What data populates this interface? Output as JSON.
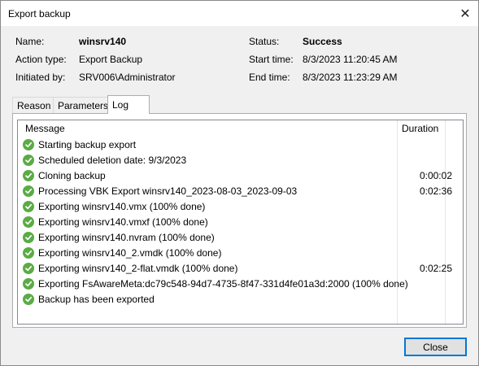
{
  "window": {
    "title": "Export backup",
    "close_glyph": "✕"
  },
  "info": {
    "name_label": "Name:",
    "name_value": "winsrv140",
    "action_label": "Action type:",
    "action_value": "Export Backup",
    "initiated_label": "Initiated by:",
    "initiated_value": "SRV006\\Administrator",
    "status_label": "Status:",
    "status_value": "Success",
    "start_label": "Start time:",
    "start_value": "8/3/2023 11:20:45 AM",
    "end_label": "End time:",
    "end_value": "8/3/2023 11:23:29 AM"
  },
  "tabs": [
    {
      "label": "Reason",
      "active": false
    },
    {
      "label": "Parameters",
      "active": false
    },
    {
      "label": "Log",
      "active": true
    }
  ],
  "log": {
    "columns": {
      "message": "Message",
      "duration": "Duration"
    },
    "rows": [
      {
        "status": "success",
        "message": "Starting backup export",
        "duration": ""
      },
      {
        "status": "success",
        "message": "Scheduled deletion date: 9/3/2023",
        "duration": ""
      },
      {
        "status": "success",
        "message": "Cloning backup",
        "duration": "0:00:02"
      },
      {
        "status": "success",
        "message": "Processing VBK Export winsrv140_2023-08-03_2023-09-03",
        "duration": "0:02:36"
      },
      {
        "status": "success",
        "message": "Exporting winsrv140.vmx (100% done)",
        "duration": ""
      },
      {
        "status": "success",
        "message": "Exporting winsrv140.vmxf (100% done)",
        "duration": ""
      },
      {
        "status": "success",
        "message": "Exporting winsrv140.nvram (100% done)",
        "duration": ""
      },
      {
        "status": "success",
        "message": "Exporting winsrv140_2.vmdk (100% done)",
        "duration": ""
      },
      {
        "status": "success",
        "message": "Exporting winsrv140_2-flat.vmdk (100% done)",
        "duration": "0:02:25"
      },
      {
        "status": "success",
        "message": "Exporting FsAwareMeta:dc79c548-94d7-4735-8f47-331d4fe01a3d:2000 (100% done)",
        "duration": ""
      },
      {
        "status": "success",
        "message": "Backup has been exported",
        "duration": ""
      }
    ]
  },
  "footer": {
    "close_label": "Close"
  },
  "colors": {
    "success_icon": "#5aac45",
    "focus_border": "#0078d7"
  },
  "icons": {
    "row_status": "check-circle-icon",
    "window_close": "close-icon"
  }
}
